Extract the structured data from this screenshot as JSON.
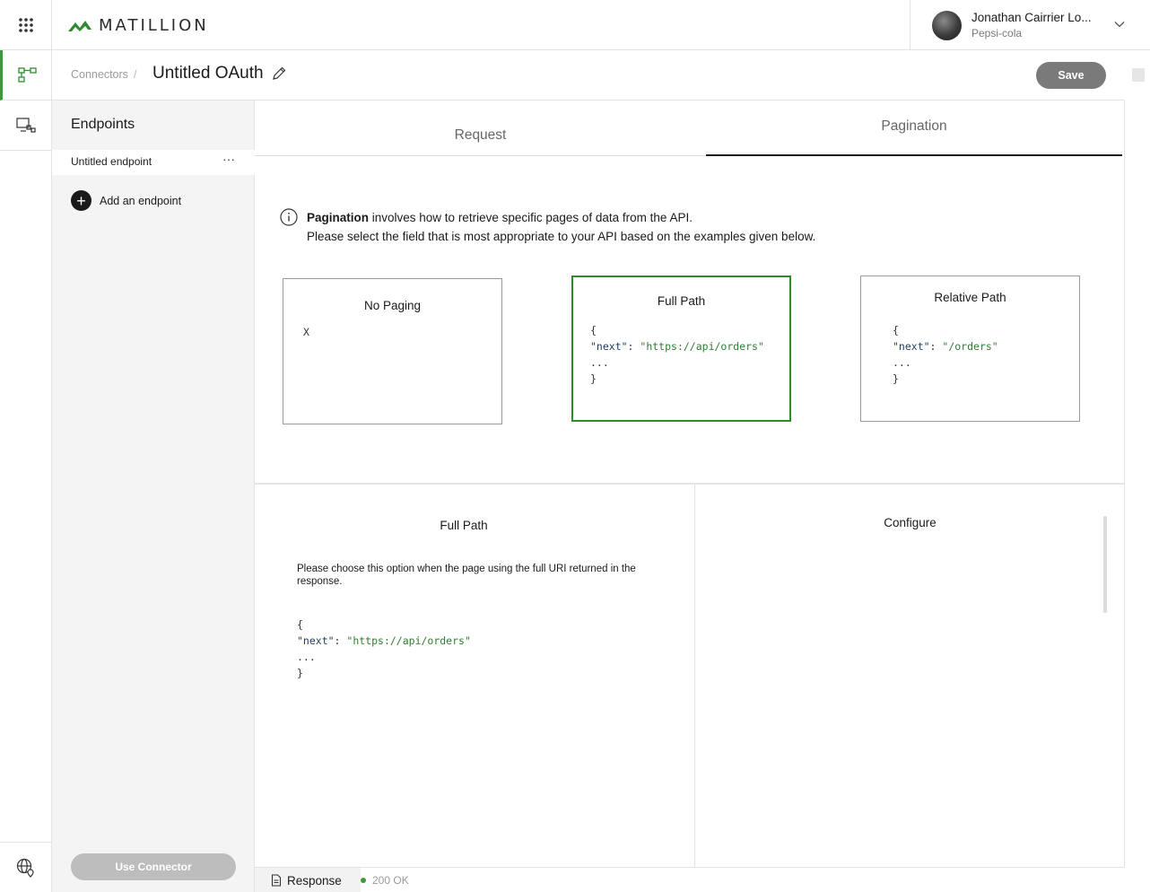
{
  "header": {
    "brand": "MATILLION",
    "user_name": "Jonathan Cairrier Lo...",
    "user_org": "Pepsi-cola"
  },
  "subheader": {
    "breadcrumb_root": "Connectors",
    "breadcrumb_sep": "/",
    "title": "Untitled OAuth",
    "save_label": "Save"
  },
  "endpoints": {
    "title": "Endpoints",
    "items": [
      {
        "label": "Untitled endpoint",
        "more": "···"
      }
    ],
    "add_label": "Add an endpoint",
    "add_symbol": "+",
    "use_connector_label": "Use Connector"
  },
  "tabs": [
    {
      "label": "Request"
    },
    {
      "label": "Pagination"
    }
  ],
  "info": {
    "bold": "Pagination",
    "line1_rest": " involves how to retrieve specific pages of data from the API.",
    "line2": "Please select the field that is most appropriate to your API based on the examples given below."
  },
  "cards": [
    {
      "title": "No Paging",
      "body": "X"
    },
    {
      "title": "Full Path",
      "open": "{",
      "key": "\"next\"",
      "colon": ": ",
      "value": "\"https://api/orders\"",
      "dots": "...",
      "close": "}"
    },
    {
      "title": "Relative Path",
      "open": "{",
      "key": "\"next\"",
      "colon": ": ",
      "value": "\"/orders\"",
      "dots": "...",
      "close": "}"
    }
  ],
  "detail": {
    "title": "Full Path",
    "description": "Please choose this option when the page using the full URI returned in the response.",
    "open": "{",
    "key": "\"next\"",
    "colon": ": ",
    "value": "\"https://api/orders\"",
    "dots": "...",
    "close": "}"
  },
  "configure": {
    "title": "Configure"
  },
  "status": {
    "response_label": "Response",
    "status_text": "200 OK"
  },
  "colors": {
    "accent_green": "#2f8a2f",
    "string_green": "#2e7d32",
    "save_bg": "#7a7a7a",
    "use_connector_bg": "#bdbdbd"
  }
}
